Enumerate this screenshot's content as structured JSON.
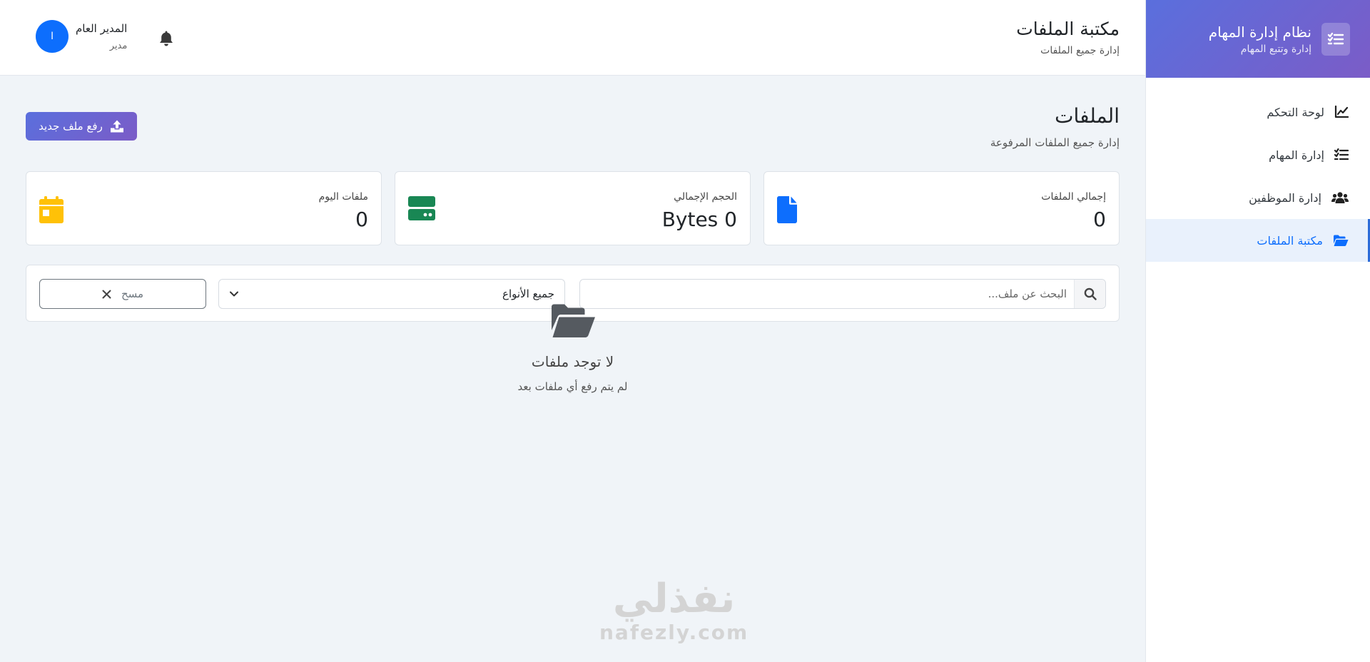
{
  "sidebar": {
    "brand_title": "نظام إدارة المهام",
    "brand_subtitle": "إدارة وتتبع المهام",
    "items": [
      {
        "label": "لوحة التحكم",
        "icon": "chart-line-icon"
      },
      {
        "label": "إدارة المهام",
        "icon": "tasks-icon"
      },
      {
        "label": "إدارة الموظفين",
        "icon": "users-icon"
      },
      {
        "label": "مكتبة الملفات",
        "icon": "folder-open-icon",
        "active": true
      }
    ]
  },
  "header": {
    "title": "مكتبة الملفات",
    "subtitle": "إدارة جميع الملفات",
    "user_name": "المدير العام",
    "user_role": "مدير",
    "avatar_initial": "ا"
  },
  "page": {
    "title": "الملفات",
    "subtitle": "إدارة جميع الملفات المرفوعة",
    "upload_label": "رفع ملف جديد"
  },
  "stats": [
    {
      "label": "إجمالي الملفات",
      "value": "0",
      "icon": "file-icon",
      "color": "#0d6efd"
    },
    {
      "label": "الحجم الإجمالي",
      "value": "0 Bytes",
      "icon": "hdd-icon",
      "color": "#198754"
    },
    {
      "label": "ملفات اليوم",
      "value": "0",
      "icon": "calendar-icon",
      "color": "#ffc107"
    }
  ],
  "filters": {
    "search_placeholder": "البحث عن ملف...",
    "type_selected": "جميع الأنواع",
    "clear_label": "مسح"
  },
  "empty_state": {
    "title": "لا توجد ملفات",
    "subtitle": "لم يتم رفع أي ملفات بعد"
  },
  "watermark": {
    "arabic": "نفذلي",
    "latin": "nafezly.com"
  },
  "colors": {
    "accent_start": "#5a6fdd",
    "accent_end": "#7b5cc7",
    "primary": "#0d6efd",
    "background": "#f0f4f8"
  }
}
